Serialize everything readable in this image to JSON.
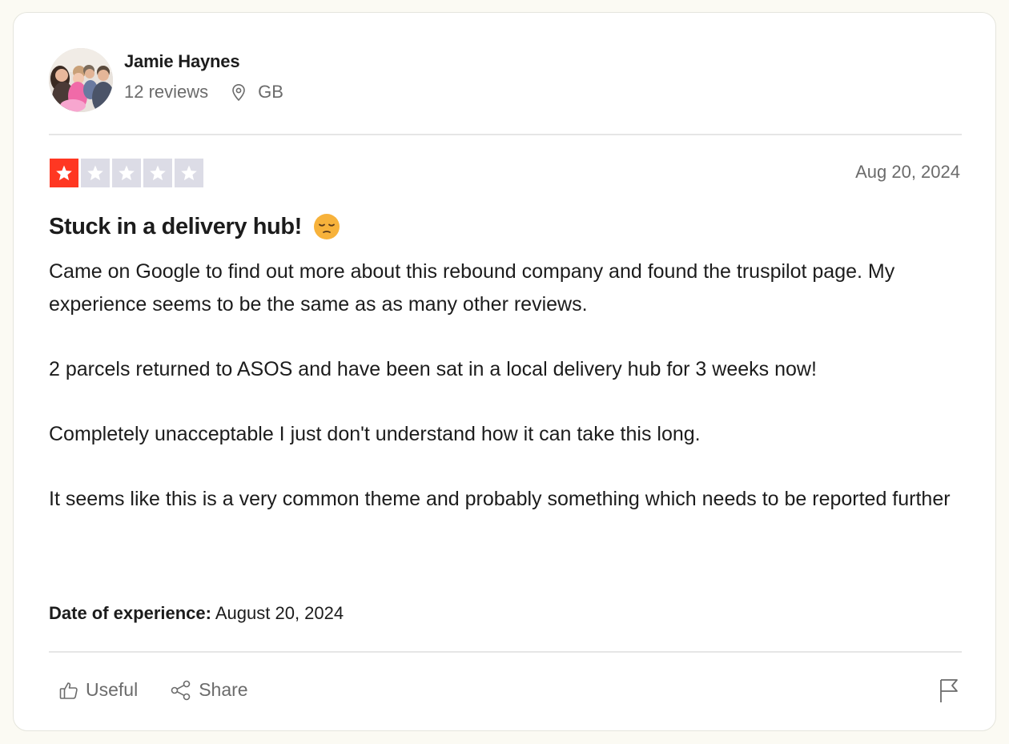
{
  "reviewer": {
    "name": "Jamie Haynes",
    "reviews_count": "12 reviews",
    "country": "GB",
    "avatar_icon": "avatar-photo"
  },
  "rating": {
    "value": 1,
    "max": 5,
    "filled_color": "#ff3722",
    "empty_color": "#dcdce6"
  },
  "review": {
    "date": "Aug 20, 2024",
    "title": "Stuck in a delivery hub!",
    "title_emoji": "pensive-face-emoji",
    "paragraphs": [
      "Came on Google to find out more about this rebound company and found the truspilot page. My experience seems to be the same as as many other reviews.",
      "2 parcels returned to ASOS and have been sat in a local delivery hub for 3 weeks now!",
      "Completely unacceptable I just don't understand how it can take this long.",
      "It seems like this is a very common theme and probably something which needs to be reported further"
    ],
    "experience_label": "Date of experience:",
    "experience_date": "August 20, 2024"
  },
  "actions": {
    "useful_label": "Useful",
    "share_label": "Share",
    "report_icon": "flag-icon"
  }
}
